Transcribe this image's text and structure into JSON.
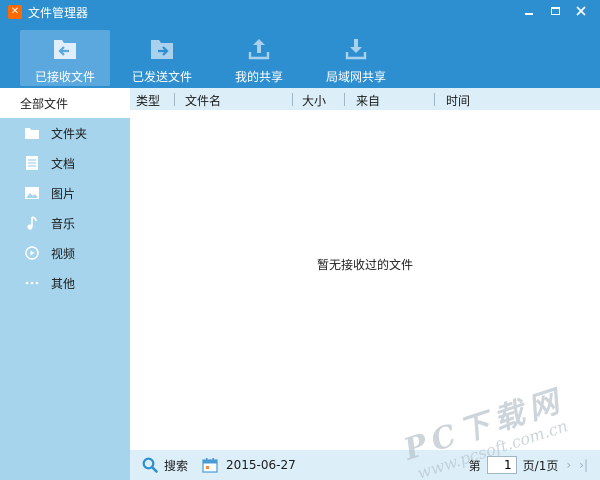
{
  "window": {
    "title": "文件管理器",
    "icons": {
      "logo": "app-logo-icon",
      "minimize": "minimize-icon",
      "maximize": "maximize-icon",
      "close": "close-icon"
    }
  },
  "toolbar": {
    "items": [
      {
        "label": "已接收文件",
        "icon": "inbox-arrow-icon",
        "active": true
      },
      {
        "label": "已发送文件",
        "icon": "outbox-arrow-icon",
        "active": false
      },
      {
        "label": "我的共享",
        "icon": "upload-icon",
        "active": false
      },
      {
        "label": "局域网共享",
        "icon": "download-icon",
        "active": false
      }
    ]
  },
  "sidebar": {
    "header": "全部文件",
    "items": [
      {
        "label": "文件夹",
        "icon": "folder-icon"
      },
      {
        "label": "文档",
        "icon": "document-icon"
      },
      {
        "label": "图片",
        "icon": "image-icon"
      },
      {
        "label": "音乐",
        "icon": "music-icon"
      },
      {
        "label": "视频",
        "icon": "video-icon"
      },
      {
        "label": "其他",
        "icon": "more-icon"
      }
    ]
  },
  "table": {
    "columns": [
      "类型",
      "文件名",
      "大小",
      "来自",
      "时间"
    ],
    "empty_message": "暂无接收过的文件"
  },
  "statusbar": {
    "search_label": "搜索",
    "date": "2015-06-27",
    "page_prefix": "第",
    "page_value": "1",
    "page_suffix": "页/1页",
    "next": "›",
    "last": "›|"
  },
  "watermark": {
    "main": "PC下载网",
    "sub": "www.pcsoft.com.cn"
  },
  "colors": {
    "titlebar": "#2e8fd0",
    "toolbar_active": "#5aa8de",
    "sidebar": "#a6d4ec",
    "header_row": "#dceff9"
  }
}
